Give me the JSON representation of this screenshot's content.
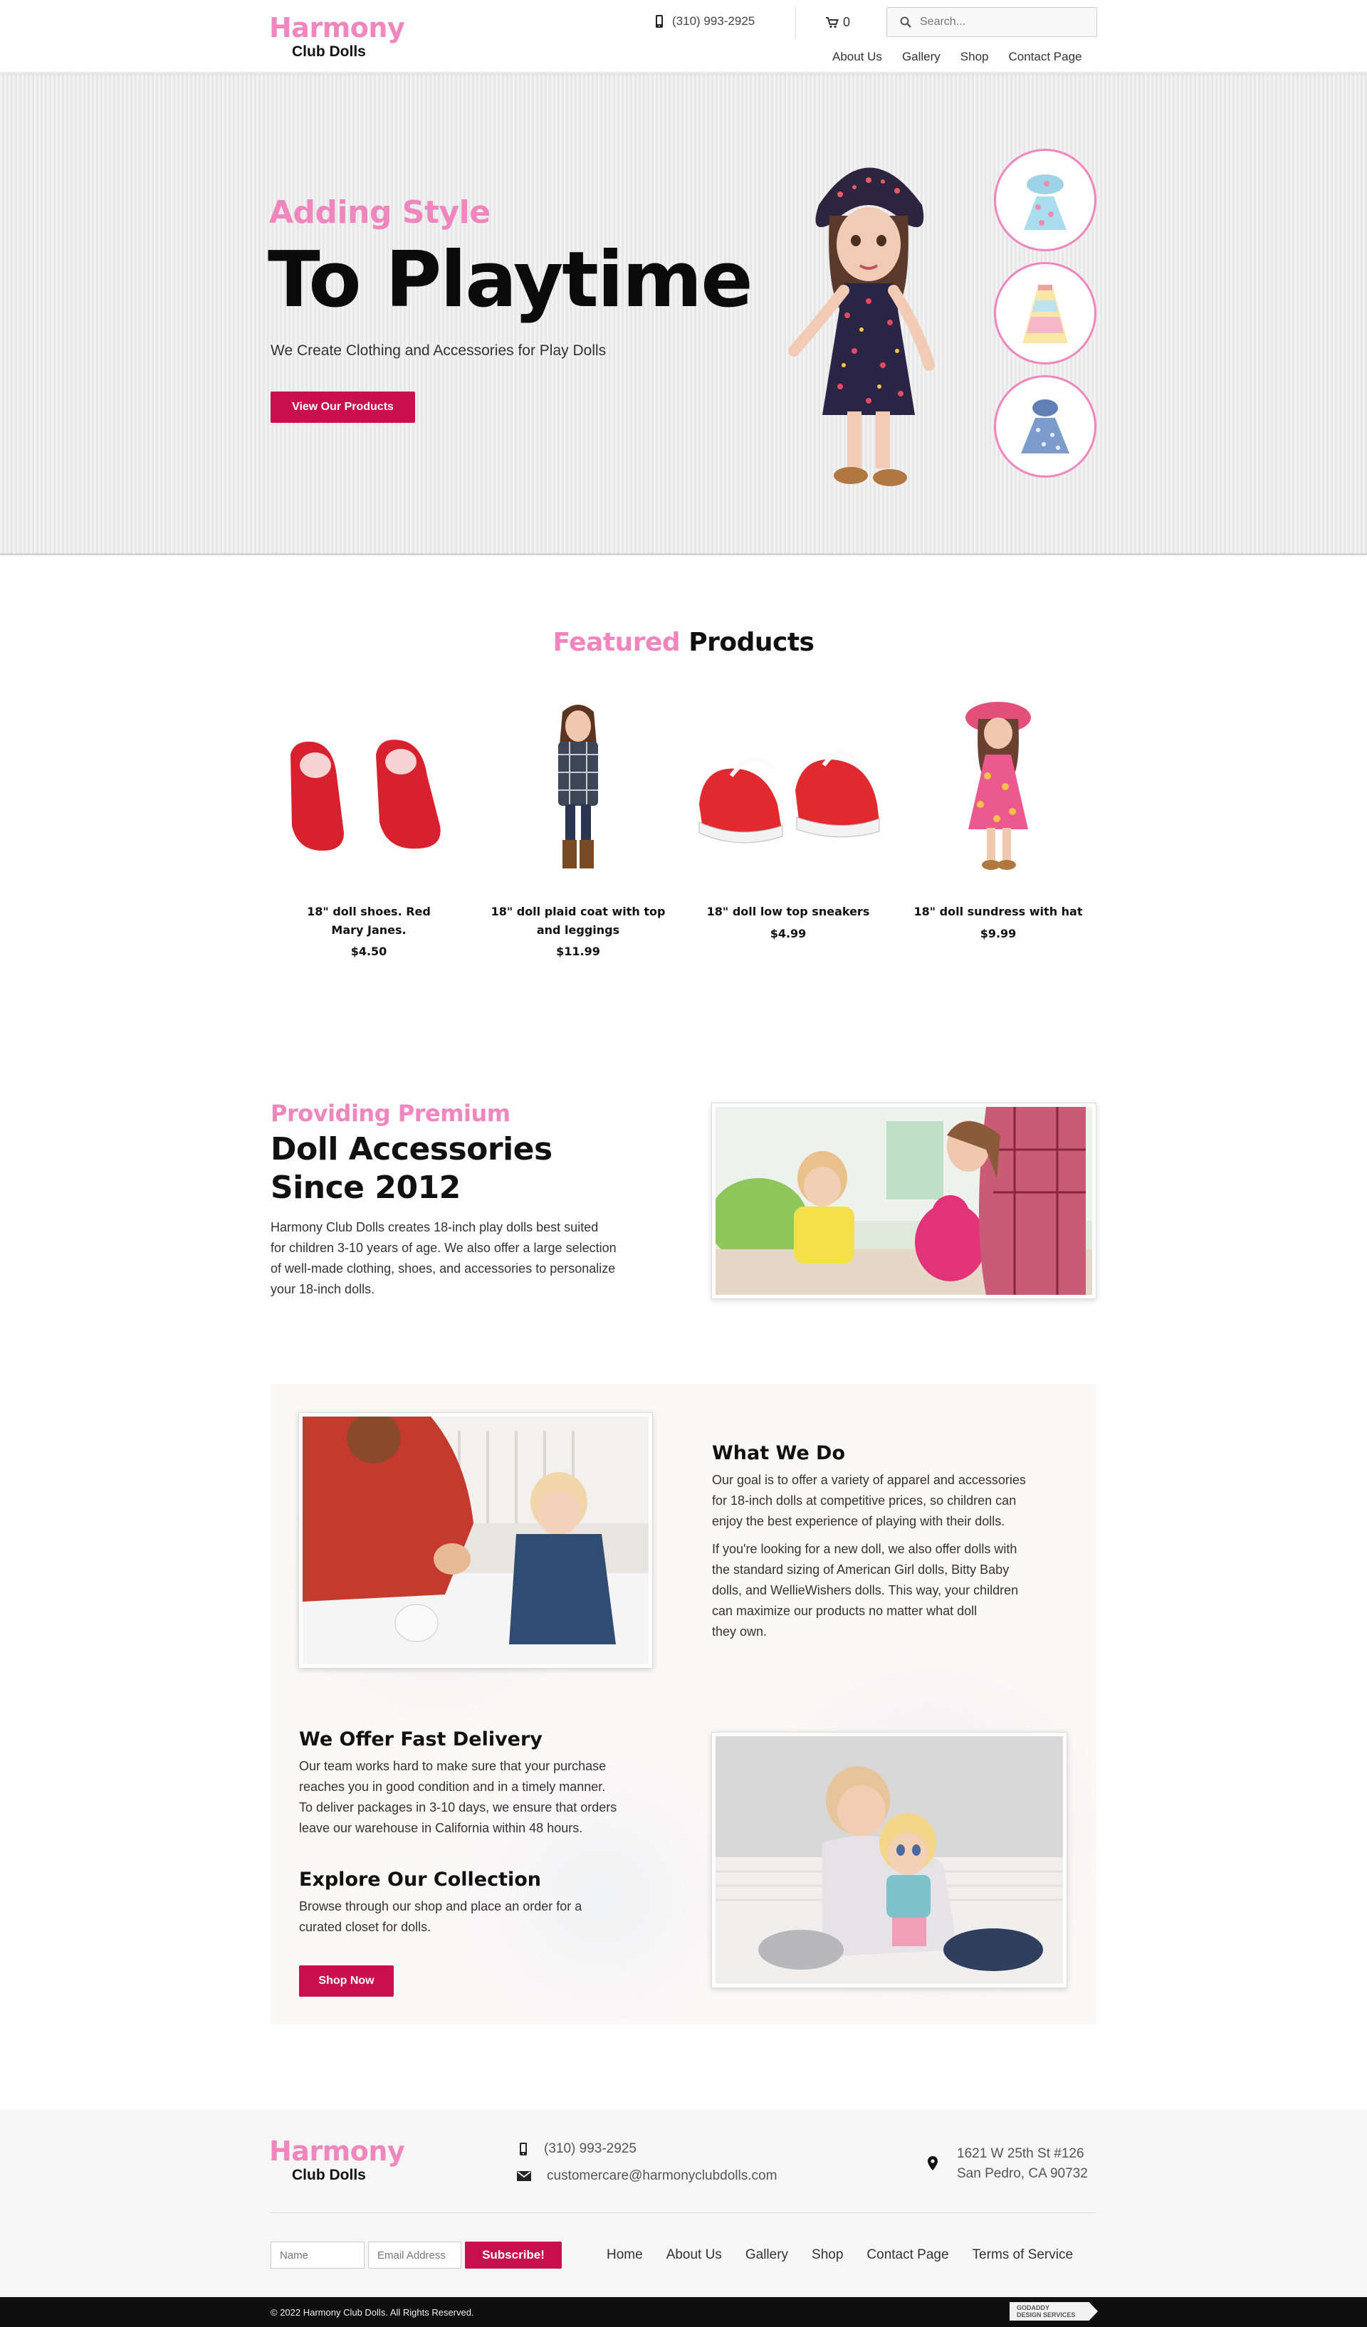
{
  "header": {
    "logo_top": "Harmony",
    "logo_bottom": "Club Dolls",
    "phone": "(310) 993-2925",
    "cart_count": "0",
    "search_placeholder": "Search...",
    "nav": [
      "About Us",
      "Gallery",
      "Shop",
      "Contact Page"
    ]
  },
  "hero": {
    "pretitle": "Adding Style",
    "title": "To Playtime",
    "subtitle": "We Create Clothing and Accessories for Play Dolls",
    "button": "View Our Products"
  },
  "featured": {
    "title_highlight": "Featured",
    "title_rest": "Products",
    "products": [
      {
        "name_line1": "18\" doll shoes. Red",
        "name_line2": "Mary Janes.",
        "price": "$4.50"
      },
      {
        "name_line1": "18\" doll plaid coat with top",
        "name_line2": "and leggings",
        "price": "$11.99"
      },
      {
        "name_line1": "18\" doll low top sneakers",
        "name_line2": "",
        "price": "$4.99"
      },
      {
        "name_line1": "18\" doll sundress with hat",
        "name_line2": "",
        "price": "$9.99"
      }
    ]
  },
  "about": {
    "pretitle": "Providing Premium",
    "title_line1": "Doll Accessories",
    "title_line2": "Since 2012",
    "lines": [
      "Harmony Club Dolls creates 18-inch play dolls best suited",
      "for children 3-10 years of age. We also offer a large selection",
      "of well-made clothing, shoes, and accessories to personalize",
      "your 18-inch dolls."
    ]
  },
  "what_we_do": {
    "title": "What We Do",
    "p1": [
      "Our goal is to offer a variety of apparel and accessories",
      "for 18-inch dolls at competitive prices, so children can",
      "enjoy the best experience of playing with their dolls."
    ],
    "p2": [
      "If you're looking for a new doll, we also offer dolls with",
      "the standard sizing of American Girl dolls, Bitty Baby",
      "dolls, and WellieWishers dolls. This way, your children",
      "can maximize our products no matter what doll",
      "they own."
    ]
  },
  "delivery": {
    "title": "We Offer Fast Delivery",
    "lines": [
      "Our team works hard to make sure that your purchase",
      "reaches you in good condition and in a timely manner.",
      "To deliver packages in 3-10 days, we ensure that orders",
      "leave our warehouse in California within 48 hours."
    ]
  },
  "collection": {
    "title": "Explore Our Collection",
    "lines": [
      "Browse through our shop and place an order for a",
      "curated closet for dolls."
    ],
    "button": "Shop Now"
  },
  "footer": {
    "logo_top": "Harmony",
    "logo_bottom": "Club Dolls",
    "phone": "(310) 993-2925",
    "email": "customercare@harmonyclubdolls.com",
    "address_line1": "1621 W 25th St #126",
    "address_line2": "San Pedro, CA 90732",
    "name_placeholder": "Name",
    "email_placeholder": "Email Address",
    "subscribe": "Subscribe!",
    "nav": [
      "Home",
      "About Us",
      "Gallery",
      "Shop",
      "Contact Page",
      "Terms of Service"
    ],
    "copyright": "© 2022 Harmony Club Dolls. All Rights Reserved.",
    "badge_line1": "GODADDY",
    "badge_line2": "DESIGN SERVICES"
  }
}
